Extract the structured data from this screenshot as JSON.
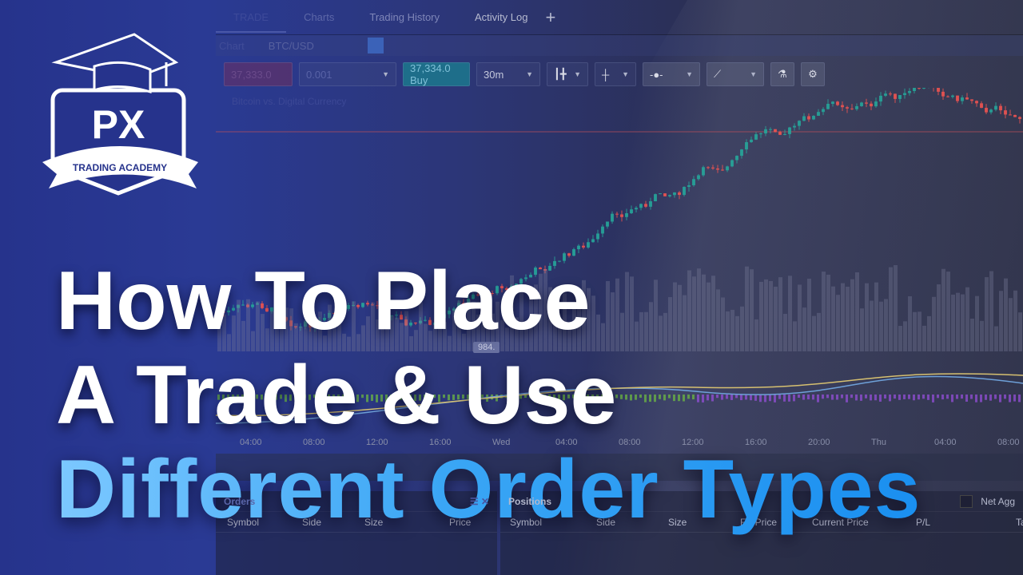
{
  "tabs": [
    "TRADE",
    "Charts",
    "Trading History",
    "Activity Log"
  ],
  "add_tab_icon": "plus-icon",
  "chart_row": {
    "label": "Chart",
    "symbol": "BTC/USD"
  },
  "toolbar": {
    "sell_price": "37,333.0",
    "quantity": "0.001",
    "buy_label": "37,334.0 Buy",
    "interval": "30m",
    "icons": [
      "candlestick-icon",
      "crosshair-icon",
      "clock-icon",
      "trendline-icon",
      "flask-icon",
      "gear-icon"
    ]
  },
  "instrument_desc": "Bitcoin vs. Digital Currency",
  "price_tag": "984.",
  "time_axis": [
    "04:00",
    "08:00",
    "12:00",
    "16:00",
    "Wed",
    "04:00",
    "08:00",
    "12:00",
    "16:00",
    "20:00",
    "Thu",
    "04:00",
    "08:00"
  ],
  "orders": {
    "title": "Orders",
    "columns": [
      "Symbol",
      "Side",
      "Size",
      "Price"
    ]
  },
  "positions": {
    "title": "Positions",
    "net_label": "Net Agg",
    "columns": [
      "Symbol",
      "Side",
      "Size",
      "Fill Price",
      "Current Price",
      "P/L",
      "Ta"
    ]
  },
  "logo": {
    "text": "PX",
    "ribbon": "TRADING ACADEMY"
  },
  "headline": {
    "line1": "How To Place",
    "line2": "A Trade & Use",
    "line3": "Different Order Types"
  },
  "colors": {
    "up": "#26a69a",
    "down": "#ef5350",
    "headline_accent": "#3aa6f5"
  }
}
